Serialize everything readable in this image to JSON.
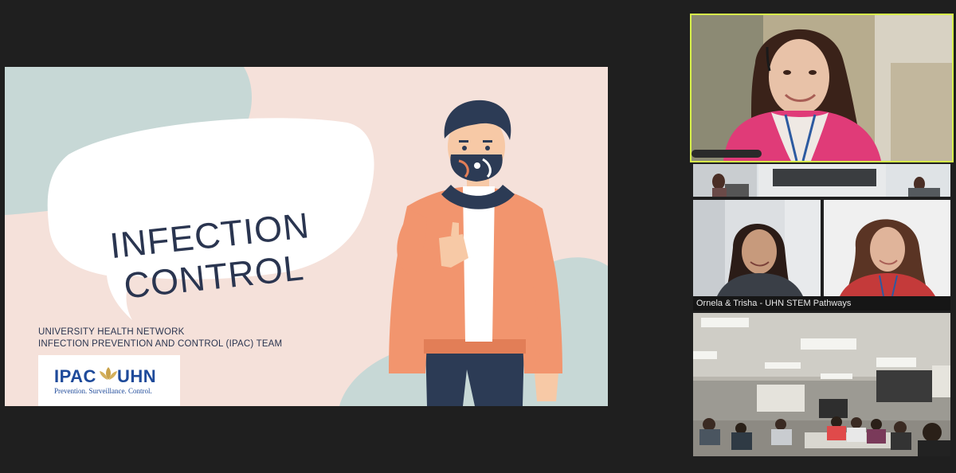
{
  "slide": {
    "title_line1": "INFECTION",
    "title_line2": "CONTROL",
    "org_line1": "UNIVERSITY HEALTH NETWORK",
    "org_line2": "INFECTION PREVENTION AND CONTROL (IPAC) TEAM",
    "logo_left": "IPAC",
    "logo_right": "UHN",
    "logo_tagline": "Prevention. Surveillance. Control."
  },
  "participants": {
    "shared_tile_label": "Ornela & Trisha - UHN STEM Pathways"
  },
  "colors": {
    "slide_bg": "#f5e1da",
    "accent_shape": "#c7d8d6",
    "title_text": "#2a3550",
    "logo_blue": "#1e4a9a",
    "active_border": "#d7f04a",
    "jacket": "#f2956e"
  }
}
